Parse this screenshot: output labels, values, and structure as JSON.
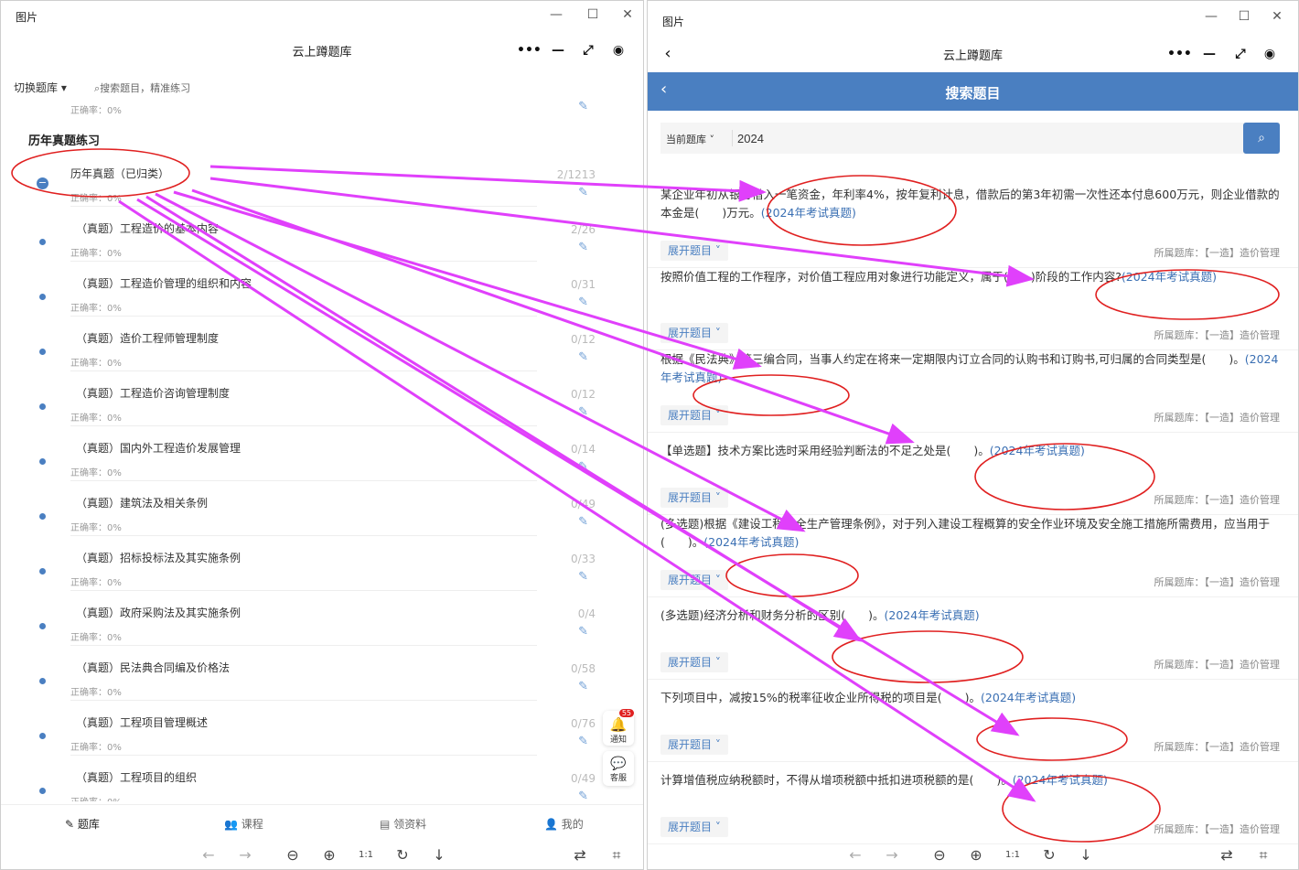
{
  "left_window": {
    "window_title": "图片",
    "app_title": "云上蹲题库",
    "switch_label": "切换题库",
    "search_placeholder": "搜索题目，精准练习",
    "top_partial_rate": "正确率：0%",
    "section_title": "历年真题练习",
    "group": {
      "title": "历年真题（已归类）",
      "rate": "正确率：0%",
      "count": "2/1213"
    },
    "items": [
      {
        "title": "（真题）工程造价的基本内容",
        "rate": "正确率：0%",
        "count": "2/26"
      },
      {
        "title": "（真题）工程造价管理的组织和内容",
        "rate": "正确率：0%",
        "count": "0/31"
      },
      {
        "title": "（真题）造价工程师管理制度",
        "rate": "正确率：0%",
        "count": "0/12"
      },
      {
        "title": "（真题）工程造价咨询管理制度",
        "rate": "正确率：0%",
        "count": "0/12"
      },
      {
        "title": "（真题）国内外工程造价发展管理",
        "rate": "正确率：0%",
        "count": "0/14"
      },
      {
        "title": "（真题）建筑法及相关条例",
        "rate": "正确率：0%",
        "count": "0/49"
      },
      {
        "title": "（真题）招标投标法及其实施条例",
        "rate": "正确率：0%",
        "count": "0/33"
      },
      {
        "title": "（真题）政府采购法及其实施条例",
        "rate": "正确率：0%",
        "count": "0/4"
      },
      {
        "title": "（真题）民法典合同编及价格法",
        "rate": "正确率：0%",
        "count": "0/58"
      },
      {
        "title": "（真题）工程项目管理概述",
        "rate": "正确率：0%",
        "count": "0/76"
      },
      {
        "title": "（真题）工程项目的组织",
        "rate": "正确率：0%",
        "count": "0/49"
      }
    ],
    "fab_notify": {
      "label": "通知",
      "badge": "55"
    },
    "fab_service": {
      "label": "客服"
    },
    "tabs": [
      "题库",
      "课程",
      "领资料",
      "我的"
    ]
  },
  "right_window": {
    "window_title": "图片",
    "app_title": "云上蹲题库",
    "header_title": "搜索题目",
    "scope_label": "当前题库",
    "search_value": "2024",
    "expand_label": "展开题目",
    "source_label": "所属题库：【一造】造价管理",
    "questions": [
      {
        "text": "某企业年初从银行借入一笔资金，年利率4%，按年复利计息，借款后的第3年初需一次性还本付息600万元，则企业借款的本金是(　　)万元。",
        "year": "(2024年考试真题)"
      },
      {
        "text": "按照价值工程的工作程序，对价值工程应用对象进行功能定义，属于(　　)阶段的工作内容?",
        "year": "(2024年考试真题)"
      },
      {
        "text": "根据《民法典》第三编合同，当事人约定在将来一定期限内订立合同的认购书和订购书,可归属的合同类型是(　　)。",
        "year": "(2024年考试真题)"
      },
      {
        "text": "【单选题】技术方案比选时采用经验判断法的不足之处是(　　)。",
        "year": "(2024年考试真题)"
      },
      {
        "text": "(多选题)根据《建设工程安全生产管理条例》，对于列入建设工程概算的安全作业环境及安全施工措施所需费用，应当用于(　　)。",
        "year": "(2024年考试真题)"
      },
      {
        "text": "(多选题)经济分析和财务分析的区别(　　)。",
        "year": "(2024年考试真题)"
      },
      {
        "text": "下列项目中，减按15%的税率征收企业所得税的项目是(　　)。",
        "year": "(2024年考试真题)"
      },
      {
        "text": "计算增值税应纳税额时，不得从增项税额中抵扣进项税额的是(　　)。",
        "year": "(2024年考试真题)"
      }
    ]
  },
  "colors": {
    "accent": "#4a7fc1",
    "annotation_arrow": "#e040fb",
    "annotation_ellipse": "#e02020"
  }
}
